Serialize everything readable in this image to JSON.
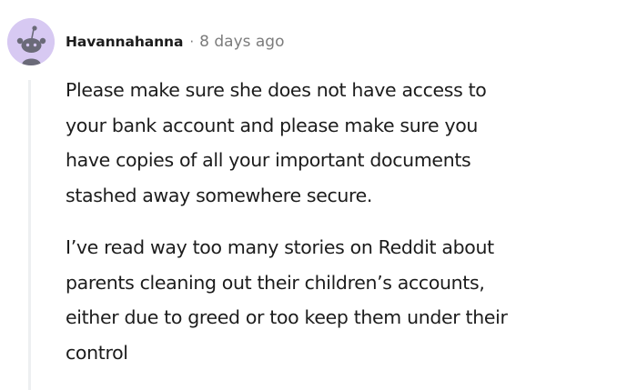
{
  "comment": {
    "username": "Havannahanna",
    "separator": "·",
    "timestamp": "8 days ago",
    "avatar_icon": "reddit-snoo-avatar-icon",
    "colors": {
      "avatar_bg": "#d7c9f2",
      "text": "#1c1c1c",
      "meta": "#7c7c7c",
      "thread_line": "#edeff1"
    },
    "paragraphs": [
      {
        "lines": [
          "Please make sure she does not have access to",
          "your bank account and please make sure you",
          "have copies of all your important documents",
          "stashed away somewhere secure."
        ]
      },
      {
        "lines": [
          "I’ve read way too many stories on Reddit about",
          "parents cleaning out their children’s accounts,",
          "either due to greed or too keep them under their",
          "control"
        ]
      }
    ]
  }
}
